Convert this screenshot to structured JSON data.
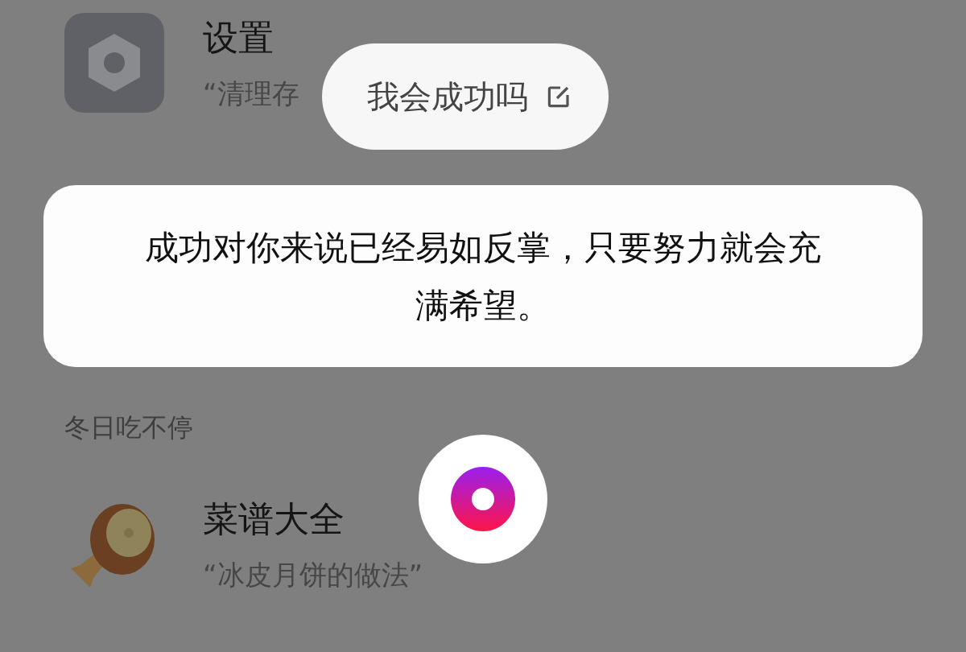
{
  "apps": [
    {
      "kind": "settings",
      "title": "设置",
      "subtitle": "“清理存"
    }
  ],
  "section": {
    "label": "冬日吃不停"
  },
  "recipes": [
    {
      "kind": "meat",
      "title": "菜谱大全",
      "subtitle": "“冰皮月饼的做法”"
    }
  ],
  "query": {
    "text": "我会成功吗"
  },
  "answer": {
    "text": "成功对你来说已经易如反掌，只要努力就会充满希望。"
  }
}
